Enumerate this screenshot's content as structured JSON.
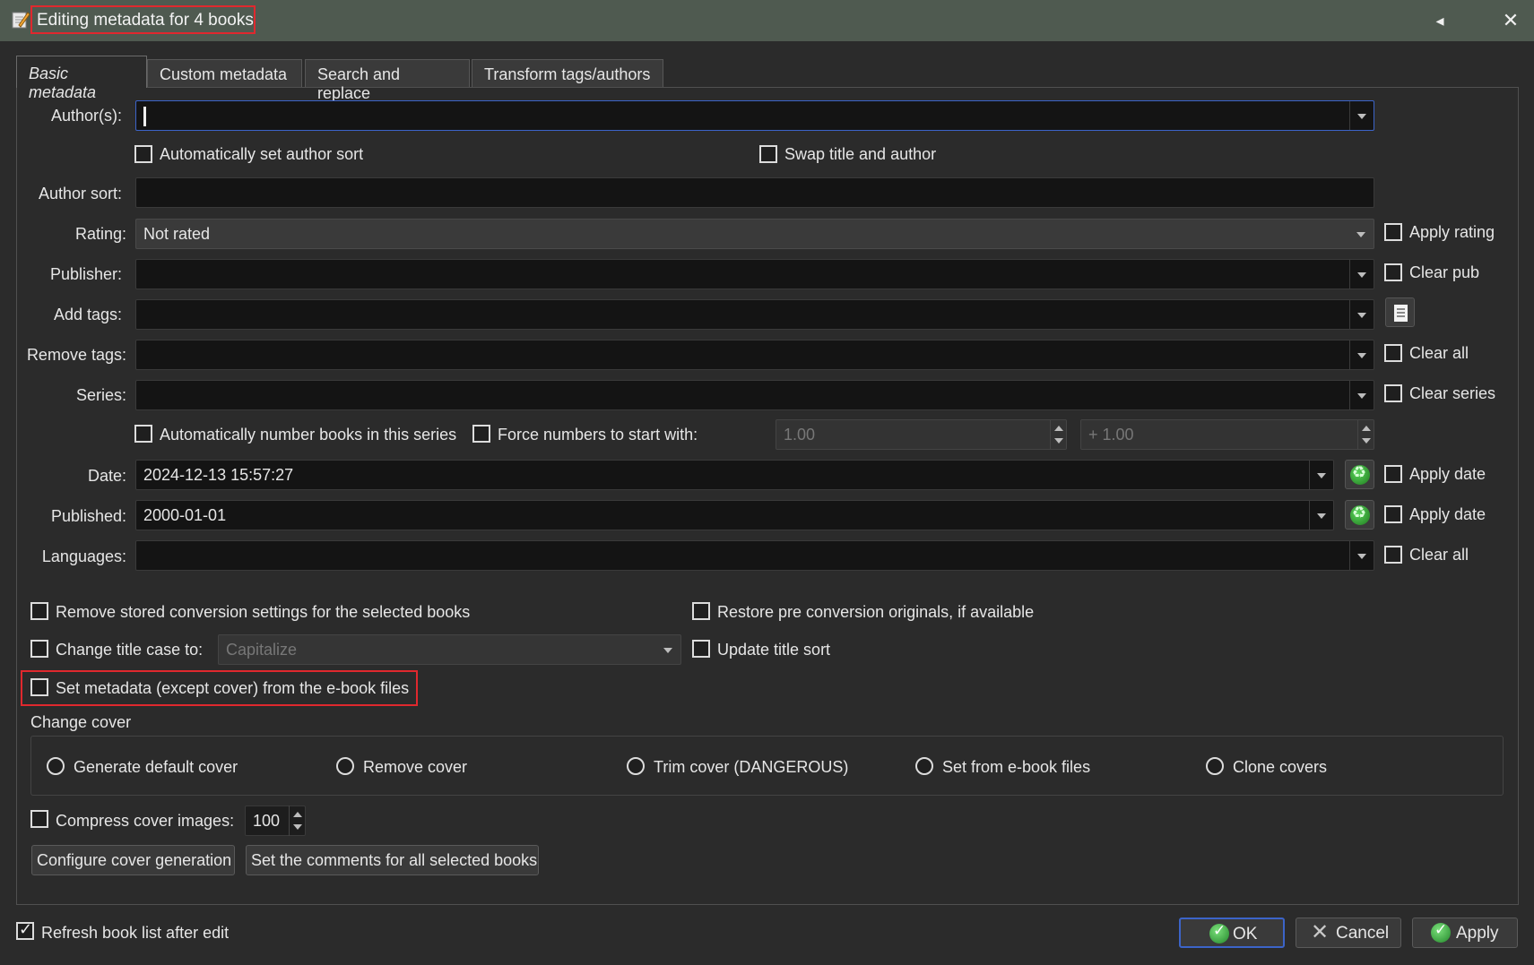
{
  "window": {
    "title": "Editing metadata for 4 books",
    "controls": {
      "back": "◂",
      "close": "✕"
    }
  },
  "tabs": [
    "Basic metadata",
    "Custom metadata",
    "Search and replace",
    "Transform tags/authors"
  ],
  "fields": {
    "authors_label": "Author(s):",
    "auto_author_sort": "Automatically set author sort",
    "swap_title_author": "Swap title and author",
    "author_sort_label": "Author sort:",
    "rating_label": "Rating:",
    "rating_value": "Not rated",
    "apply_rating": "Apply rating",
    "publisher_label": "Publisher:",
    "clear_pub": "Clear pub",
    "add_tags_label": "Add tags:",
    "remove_tags_label": "Remove tags:",
    "clear_all_tags": "Clear all",
    "series_label": "Series:",
    "clear_series": "Clear series",
    "auto_number_series": "Automatically number books in this series",
    "force_numbers": "Force numbers to start with:",
    "series_start_value": "1.00",
    "series_increment_value": "+ 1.00",
    "date_label": "Date:",
    "date_value": "2024-12-13 15:57:27",
    "apply_date": "Apply date",
    "published_label": "Published:",
    "published_value": "2000-01-01",
    "apply_published": "Apply date",
    "languages_label": "Languages:",
    "clear_languages": "Clear all"
  },
  "options": {
    "remove_conversion": "Remove stored conversion settings for the selected books",
    "restore_originals": "Restore pre conversion originals, if available",
    "change_title_case": "Change title case to:",
    "title_case_value": "Capitalize",
    "update_title_sort": "Update title sort",
    "set_metadata_from_files": "Set metadata (except cover) from the e-book files"
  },
  "cover": {
    "group_label": "Change cover",
    "radios": [
      "Generate default cover",
      "Remove cover",
      "Trim cover (DANGEROUS)",
      "Set from e-book files",
      "Clone covers"
    ],
    "compress_label": "Compress cover images:",
    "compress_value": "100",
    "configure_button": "Configure cover generation",
    "comments_button": "Set the comments for all selected books"
  },
  "footer": {
    "refresh_label": "Refresh book list after edit",
    "refresh_checked": true,
    "ok": "OK",
    "cancel": "Cancel",
    "apply": "Apply"
  },
  "colors": {
    "titlebar": "#4f5a50",
    "background": "#2b2b2b",
    "highlight": "#e0282e",
    "focus": "#3c64c8"
  }
}
